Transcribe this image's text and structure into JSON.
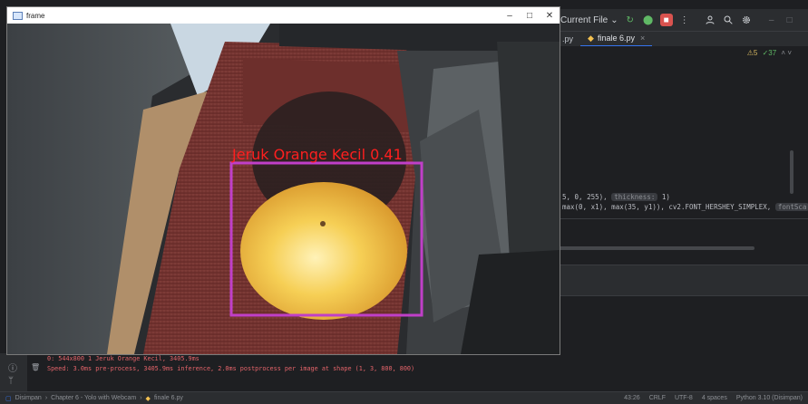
{
  "ide": {
    "toolbar": {
      "run_config": "Current File",
      "run_config_chevron": "⌄",
      "kebab": "⋮"
    },
    "tabs": [
      {
        "label": ".py"
      },
      {
        "label": "finale 6.py",
        "close": "×"
      }
    ],
    "inspection": {
      "warnings": "⚠5",
      "checks": "✓37"
    },
    "code_line1": {
      "pre": "5, 0, 255),",
      "hint": "thickness:",
      "post": "1)"
    },
    "code_line2": {
      "pre": "max(0, x1), max(35, y1)), cv2.FONT_HERSHEY_SIMPLEX,",
      "hint": "fontSca"
    },
    "console": {
      "line1": "0: 544x800 1 Jeruk Orange Kecil, 3405.9ms",
      "line2": "Speed: 3.0ms pre-process, 3405.9ms inference, 2.0ms postprocess per image at shape (1, 3, 800, 800)"
    },
    "status": {
      "crumbs": [
        "Disimpan",
        "Chapter 6 - Yolo with Webcam",
        "finale 6.py"
      ],
      "position": "43:26",
      "line_sep": "CRLF",
      "encoding": "UTF-8",
      "indent": "4 spaces",
      "interpreter": "Python 3.10 (Disimpan)"
    }
  },
  "frame_window": {
    "title": "frame",
    "controls": {
      "minimize": "–",
      "maximize": "□",
      "close": "✕"
    },
    "detection": {
      "label": "Jeruk Orange Kecil 0.41",
      "box_color": "#c03fc8",
      "label_color": "#ff1f1f"
    }
  },
  "colors": {
    "ide_bg": "#1e1f22",
    "accent": "#3574f0",
    "console_error": "#e5646a"
  }
}
